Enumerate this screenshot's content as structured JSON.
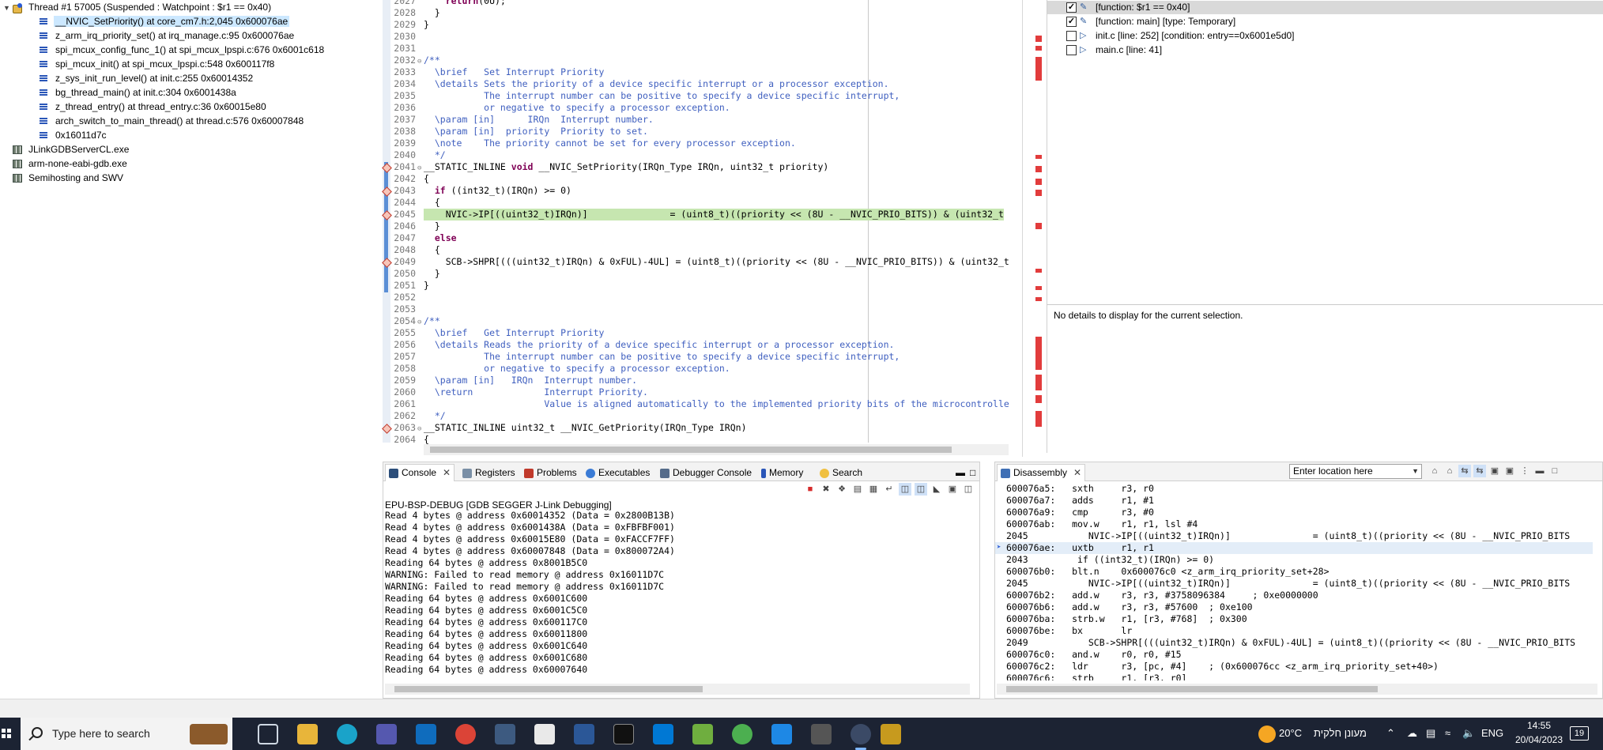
{
  "debug": {
    "thread": "Thread #1 57005 (Suspended : Watchpoint : $r1 == 0x40)",
    "frames": [
      "__NVIC_SetPriority() at core_cm7.h:2,045 0x600076ae",
      "z_arm_irq_priority_set() at irq_manage.c:95 0x600076ae",
      "spi_mcux_config_func_1() at spi_mcux_lpspi.c:676 0x6001c618",
      "spi_mcux_init() at spi_mcux_lpspi.c:548 0x600117f8",
      "z_sys_init_run_level() at init.c:255 0x60014352",
      "bg_thread_main() at init.c:304 0x6001438a",
      "z_thread_entry() at thread_entry.c:36 0x60015e80",
      "arch_switch_to_main_thread() at thread.c:576 0x60007848",
      "0x16011d7c"
    ],
    "processes": [
      "JLinkGDBServerCL.exe",
      "arm-none-eabi-gdb.exe",
      "Semihosting and SWV"
    ]
  },
  "editor": {
    "lines": [
      {
        "n": "2027",
        "t": "    return(0U);"
      },
      {
        "n": "2028",
        "t": "  }"
      },
      {
        "n": "2029",
        "t": "}"
      },
      {
        "n": "2030",
        "t": ""
      },
      {
        "n": "2031",
        "t": ""
      },
      {
        "n": "2032",
        "t": "/**",
        "c": 1,
        "f": 1
      },
      {
        "n": "2033",
        "t": "  \\brief   Set Interrupt Priority",
        "c": 1
      },
      {
        "n": "2034",
        "t": "  \\details Sets the priority of a device specific interrupt or a processor exception.",
        "c": 1
      },
      {
        "n": "2035",
        "t": "           The interrupt number can be positive to specify a device specific interrupt,",
        "c": 1
      },
      {
        "n": "2036",
        "t": "           or negative to specify a processor exception.",
        "c": 1
      },
      {
        "n": "2037",
        "t": "  \\param [in]      IRQn  Interrupt number.",
        "c": 1
      },
      {
        "n": "2038",
        "t": "  \\param [in]  priority  Priority to set.",
        "c": 1
      },
      {
        "n": "2039",
        "t": "  \\note    The priority cannot be set for every processor exception.",
        "c": 1
      },
      {
        "n": "2040",
        "t": "  */",
        "c": 1
      },
      {
        "n": "2041",
        "t": "__STATIC_INLINE void __NVIC_SetPriority(IRQn_Type IRQn, uint32_t priority)",
        "b": 1,
        "f": 1
      },
      {
        "n": "2042",
        "t": "{"
      },
      {
        "n": "2043",
        "t": "  if ((int32_t)(IRQn) >= 0)",
        "b": 1
      },
      {
        "n": "2044",
        "t": "  {"
      },
      {
        "n": "2045",
        "t": "    NVIC->IP[((uint32_t)IRQn)]               = (uint8_t)((priority << (8U - __NVIC_PRIO_BITS)) & (uint32_t",
        "b": 1,
        "h": 1
      },
      {
        "n": "2046",
        "t": "  }"
      },
      {
        "n": "2047",
        "t": "  else"
      },
      {
        "n": "2048",
        "t": "  {"
      },
      {
        "n": "2049",
        "t": "    SCB->SHPR[(((uint32_t)IRQn) & 0xFUL)-4UL] = (uint8_t)((priority << (8U - __NVIC_PRIO_BITS)) & (uint32_t",
        "b": 1
      },
      {
        "n": "2050",
        "t": "  }"
      },
      {
        "n": "2051",
        "t": "}"
      },
      {
        "n": "2052",
        "t": ""
      },
      {
        "n": "2053",
        "t": ""
      },
      {
        "n": "2054",
        "t": "/**",
        "c": 1,
        "f": 1
      },
      {
        "n": "2055",
        "t": "  \\brief   Get Interrupt Priority",
        "c": 1
      },
      {
        "n": "2056",
        "t": "  \\details Reads the priority of a device specific interrupt or a processor exception.",
        "c": 1
      },
      {
        "n": "2057",
        "t": "           The interrupt number can be positive to specify a device specific interrupt,",
        "c": 1
      },
      {
        "n": "2058",
        "t": "           or negative to specify a processor exception.",
        "c": 1
      },
      {
        "n": "2059",
        "t": "  \\param [in]   IRQn  Interrupt number.",
        "c": 1
      },
      {
        "n": "2060",
        "t": "  \\return             Interrupt Priority.",
        "c": 1
      },
      {
        "n": "2061",
        "t": "                      Value is aligned automatically to the implemented priority bits of the microcontrolle",
        "c": 1
      },
      {
        "n": "2062",
        "t": "  */",
        "c": 1
      },
      {
        "n": "2063",
        "t": "__STATIC_INLINE uint32_t __NVIC_GetPriority(IRQn_Type IRQn)",
        "b": 1,
        "f": 1
      },
      {
        "n": "2064",
        "t": "{"
      }
    ]
  },
  "breakpoints": {
    "items": [
      {
        "label": "[function: $r1 == 0x40]",
        "checked": true,
        "icon": "watchpoint-icon"
      },
      {
        "label": "[function: main] [type: Temporary]",
        "checked": true,
        "icon": "watchpoint-icon"
      },
      {
        "label": "init.c [line: 252] [condition: entry==0x6001e5d0]",
        "checked": false,
        "icon": "line-breakpoint-icon"
      },
      {
        "label": "main.c [line: 41]",
        "checked": false,
        "icon": "line-breakpoint-icon"
      }
    ],
    "details": "No details to display for the current selection."
  },
  "console": {
    "tabs": [
      "Console",
      "Registers",
      "Problems",
      "Executables",
      "Debugger Console",
      "Memory",
      "Search"
    ],
    "title": "EPU-BSP-DEBUG [GDB SEGGER J-Link Debugging]",
    "lines": [
      "Read 4 bytes @ address 0x60014352 (Data = 0x2800B13B)",
      "Read 4 bytes @ address 0x6001438A (Data = 0xFBFBF001)",
      "Read 4 bytes @ address 0x60015E80 (Data = 0xFACCF7FF)",
      "Read 4 bytes @ address 0x60007848 (Data = 0x800072A4)",
      "Reading 64 bytes @ address 0x8001B5C0",
      "WARNING: Failed to read memory @ address 0x16011D7C",
      "WARNING: Failed to read memory @ address 0x16011D7C",
      "Reading 64 bytes @ address 0x6001C600",
      "Reading 64 bytes @ address 0x6001C5C0",
      "Reading 64 bytes @ address 0x600117C0",
      "Reading 64 bytes @ address 0x60011800",
      "Reading 64 bytes @ address 0x6001C640",
      "Reading 64 bytes @ address 0x6001C680",
      "Reading 64 bytes @ address 0x60007640"
    ]
  },
  "disassembly": {
    "tab": "Disassembly",
    "location_placeholder": "Enter location here",
    "lines": [
      "600076a5:   sxth     r3, r0",
      "600076a7:   adds     r1, #1",
      "600076a9:   cmp      r3, #0",
      "600076ab:   mov.w    r1, r1, lsl #4",
      "2045           NVIC->IP[((uint32_t)IRQn)]               = (uint8_t)((priority << (8U - __NVIC_PRIO_BITS",
      "600076ae:   uxtb     r1, r1",
      "2043         if ((int32_t)(IRQn) >= 0)",
      "600076b0:   blt.n    0x600076c0 <z_arm_irq_priority_set+28>",
      "2045           NVIC->IP[((uint32_t)IRQn)]               = (uint8_t)((priority << (8U - __NVIC_PRIO_BITS",
      "600076b2:   add.w    r3, r3, #3758096384     ; 0xe0000000",
      "600076b6:   add.w    r3, r3, #57600  ; 0xe100",
      "600076ba:   strb.w   r1, [r3, #768]  ; 0x300",
      "600076be:   bx       lr",
      "2049           SCB->SHPR[(((uint32_t)IRQn) & 0xFUL)-4UL] = (uint8_t)((priority << (8U - __NVIC_PRIO_BITS",
      "600076c0:   and.w    r0, r0, #15",
      "600076c2:   ldr      r3, [pc, #4]    ; (0x600076cc <z_arm_irq_priority_set+40>)",
      "600076c6:   strb     r1, [r3, r0]"
    ]
  },
  "taskbar": {
    "search_placeholder": "Type here to search",
    "weather": "20°C",
    "weather_text": "מעונן חלקית",
    "language": "ENG",
    "time": "14:55",
    "date": "20/04/2023",
    "notifications": "19"
  }
}
